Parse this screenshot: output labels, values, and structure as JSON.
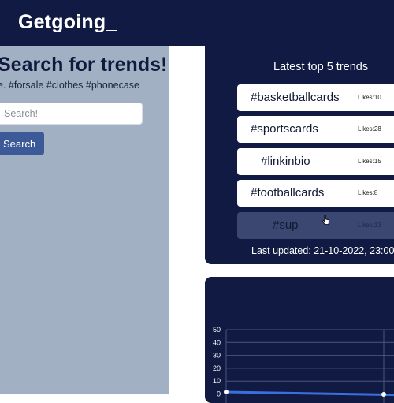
{
  "header": {
    "brand": "Getgoing_"
  },
  "search": {
    "title": "Search for trends!",
    "hint": "e. #forsale #clothes #phonecase",
    "placeholder": "Search!",
    "button_label": "Search"
  },
  "trends": {
    "title": "Latest top 5 trends",
    "items": [
      {
        "tag": "#basketballcards",
        "likes": "Likes:10"
      },
      {
        "tag": "#sportscards",
        "likes": "Likes:28"
      },
      {
        "tag": "#linkinbio",
        "likes": "Likes:15"
      },
      {
        "tag": "#footballcards",
        "likes": "Likes:8"
      },
      {
        "tag": "#sup",
        "likes": "Likes:13"
      }
    ],
    "last_updated": "Last updated: 21-10-2022, 23:00"
  },
  "chart_data": {
    "type": "line",
    "y_ticks": [
      "50",
      "40",
      "30",
      "20",
      "10",
      "0"
    ],
    "ylim": [
      0,
      50
    ],
    "grid": true,
    "series_color": "#3b6fe0"
  },
  "colors": {
    "navy": "#101a42",
    "panel": "#a2b0c4",
    "button": "#3d5a98"
  }
}
